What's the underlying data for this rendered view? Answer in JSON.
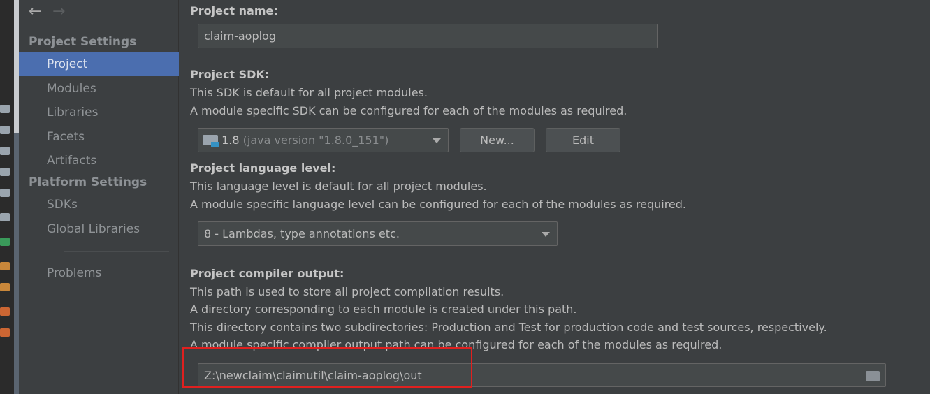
{
  "sidebar": {
    "back_icon": "arrow-left-icon",
    "forward_icon": "arrow-right-icon",
    "groups": [
      {
        "label": "Project Settings",
        "items": [
          "Project",
          "Modules",
          "Libraries",
          "Facets",
          "Artifacts"
        ]
      },
      {
        "label": "Platform Settings",
        "items": [
          "SDKs",
          "Global Libraries"
        ]
      }
    ],
    "problems": "Problems",
    "selected": "Project",
    "selected_color": "#4b6eaf"
  },
  "main": {
    "name": {
      "label": "Project name:",
      "value": "claim-aoplog"
    },
    "sdk": {
      "label": "Project SDK:",
      "lines": [
        "This SDK is default for all project modules.",
        "A module specific SDK can be configured for each of the modules as required."
      ],
      "value": "1.8",
      "value_detail": "(java version \"1.8.0_151\")",
      "new_button": "New...",
      "edit_button": "Edit"
    },
    "language": {
      "label": "Project language level:",
      "lines": [
        "This language level is default for all project modules.",
        "A module specific language level can be configured for each of the modules as required."
      ],
      "value": "8 - Lambdas, type annotations etc."
    },
    "output": {
      "label": "Project compiler output:",
      "lines": [
        "This path is used to store all project compilation results.",
        "A directory corresponding to each module is created under this path.",
        "This directory contains two subdirectories: Production and Test for production code and test sources, respectively.",
        "A module specific compiler output path can be configured for each of the modules as required."
      ],
      "value": "Z:\\newclaim\\claimutil\\claim-aoplog\\out",
      "highlight_color": "#e0201f"
    }
  }
}
